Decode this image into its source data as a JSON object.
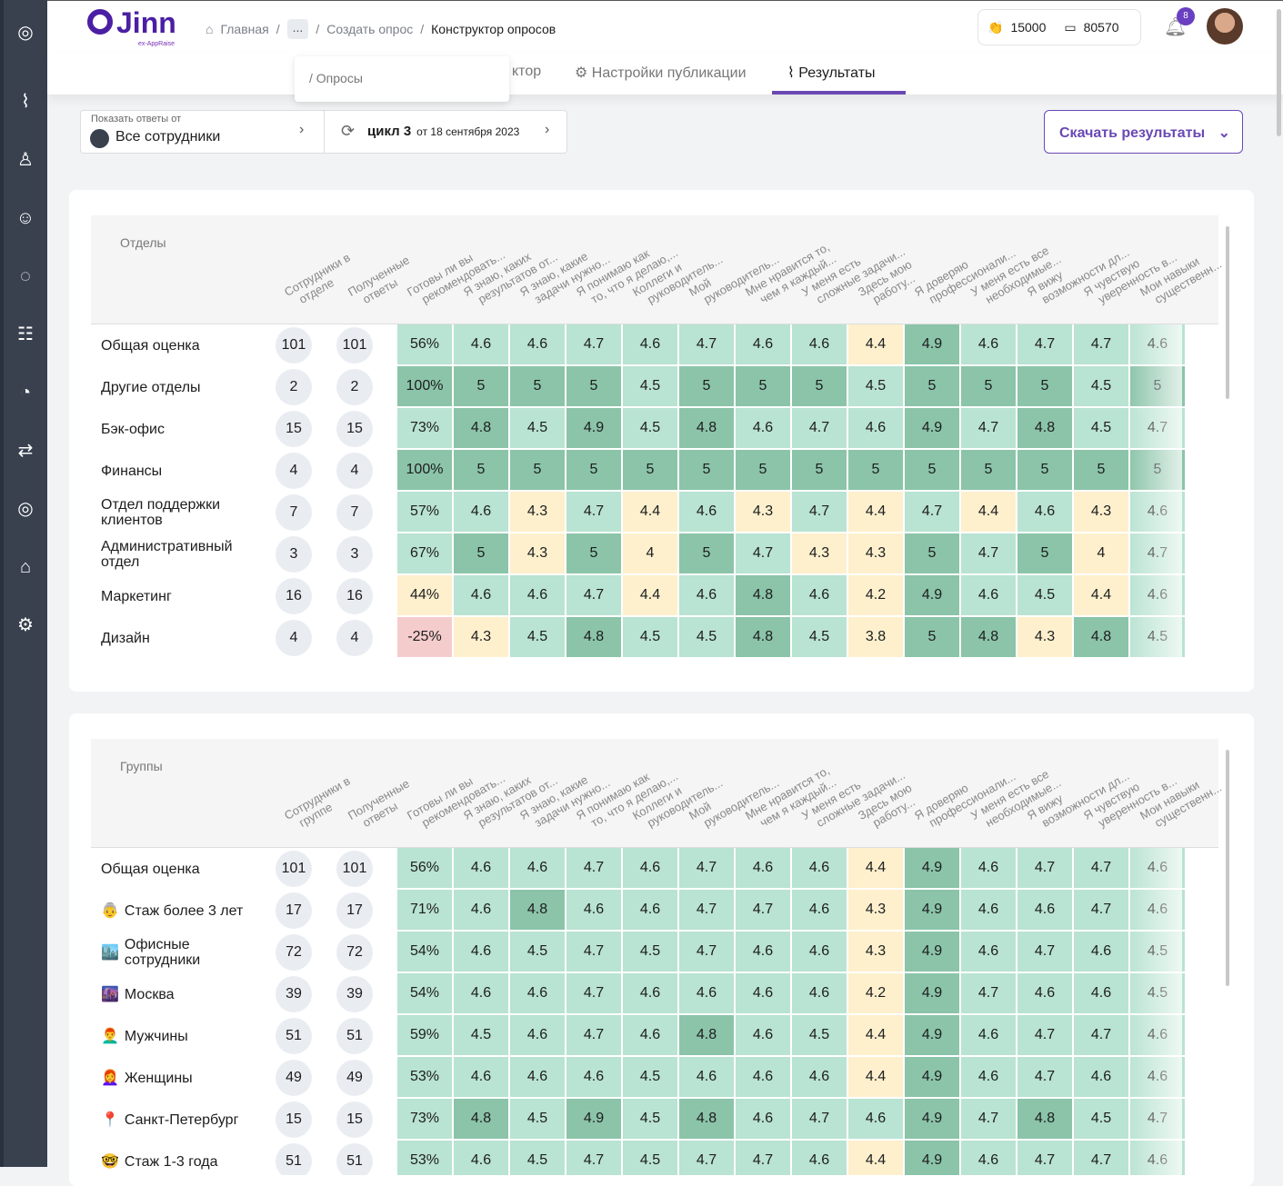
{
  "header": {
    "logo": "Jinn",
    "logo_sub": "ex-AppRaise",
    "breadcrumbs": [
      "Главная",
      "...",
      "Создать опрос",
      "Конструктор опросов"
    ],
    "claps": "15000",
    "wallet": "80570",
    "notifications": "8"
  },
  "breadcrumb_popup": {
    "item": "Опросы"
  },
  "tabs": [
    {
      "label": "Конструктор",
      "visible_text": "ктор"
    },
    {
      "label": "Настройки публикации"
    },
    {
      "label": "Результаты",
      "active": true
    }
  ],
  "filter": {
    "caption": "Показать ответы от",
    "value": "Все сотрудники",
    "cycle": "цикл 3",
    "cycle_date": "от 18 сентября 2023"
  },
  "download_label": "Скачать результаты",
  "colors": {
    "accent": "#6a48b4",
    "high": "#8bc4a9",
    "mid": "#b9e3d2",
    "low": "#fef0cd",
    "negative": "#f5cccc"
  },
  "question_headers": [
    [
      "Готовы ли вы",
      "рекомендовать..."
    ],
    [
      "Я знаю, каких",
      "результатов от..."
    ],
    [
      "Я знаю, какие",
      "задачи нужно..."
    ],
    [
      "Я понимаю как",
      "то, что я делаю,..."
    ],
    [
      "Коллеги и",
      "руководитель..."
    ],
    [
      "Мой",
      "руководитель..."
    ],
    [
      "Мне нравится то,",
      "чем я каждый..."
    ],
    [
      "У меня есть",
      "сложные задачи..."
    ],
    [
      "Здесь мою",
      "работу..."
    ],
    [
      "Я доверяю",
      "профессионали..."
    ],
    [
      "У меня есть все",
      "необходимые..."
    ],
    [
      "Я вижу",
      "возможности дл..."
    ],
    [
      "Я чувствую",
      "уверенность в..."
    ],
    [
      "Мои навыки",
      "существенн..."
    ]
  ],
  "departments": {
    "title": "Отделы",
    "col_employees": [
      "Сотрудники в",
      "отделе"
    ],
    "col_answers": [
      "Полученные",
      "ответы"
    ],
    "rows": [
      {
        "name": "Общая оценка",
        "employees": "101",
        "answers": "101",
        "values": [
          "56%",
          "4.6",
          "4.6",
          "4.7",
          "4.6",
          "4.7",
          "4.6",
          "4.6",
          "4.4",
          "4.9",
          "4.6",
          "4.7",
          "4.7",
          "4.6"
        ]
      },
      {
        "name": "Другие отделы",
        "employees": "2",
        "answers": "2",
        "values": [
          "100%",
          "5",
          "5",
          "5",
          "4.5",
          "5",
          "5",
          "5",
          "4.5",
          "5",
          "5",
          "5",
          "4.5",
          "5"
        ]
      },
      {
        "name": "Бэк-офис",
        "employees": "15",
        "answers": "15",
        "values": [
          "73%",
          "4.8",
          "4.5",
          "4.9",
          "4.5",
          "4.8",
          "4.6",
          "4.7",
          "4.6",
          "4.9",
          "4.7",
          "4.8",
          "4.5",
          "4.7"
        ]
      },
      {
        "name": "Финансы",
        "employees": "4",
        "answers": "4",
        "values": [
          "100%",
          "5",
          "5",
          "5",
          "5",
          "5",
          "5",
          "5",
          "5",
          "5",
          "5",
          "5",
          "5",
          "5"
        ]
      },
      {
        "name": "Отдел поддержки клиентов",
        "employees": "7",
        "answers": "7",
        "values": [
          "57%",
          "4.6",
          "4.3",
          "4.7",
          "4.4",
          "4.6",
          "4.3",
          "4.7",
          "4.4",
          "4.7",
          "4.4",
          "4.6",
          "4.3",
          "4.6"
        ]
      },
      {
        "name": "Административный отдел",
        "employees": "3",
        "answers": "3",
        "values": [
          "67%",
          "5",
          "4.3",
          "5",
          "4",
          "5",
          "4.7",
          "4.3",
          "4.3",
          "5",
          "4.7",
          "5",
          "4",
          "4.7"
        ]
      },
      {
        "name": "Маркетинг",
        "employees": "16",
        "answers": "16",
        "values": [
          "44%",
          "4.6",
          "4.6",
          "4.7",
          "4.4",
          "4.6",
          "4.8",
          "4.6",
          "4.2",
          "4.9",
          "4.6",
          "4.5",
          "4.4",
          "4.6"
        ]
      },
      {
        "name": "Дизайн",
        "employees": "4",
        "answers": "4",
        "values": [
          "-25%",
          "4.3",
          "4.5",
          "4.8",
          "4.5",
          "4.5",
          "4.8",
          "4.5",
          "3.8",
          "5",
          "4.8",
          "4.3",
          "4.8",
          "4.5"
        ]
      }
    ]
  },
  "groups": {
    "title": "Группы",
    "col_employees": [
      "Сотрудники в",
      "группе"
    ],
    "col_answers": [
      "Полученные",
      "ответы"
    ],
    "rows": [
      {
        "name": "Общая оценка",
        "icon": "",
        "employees": "101",
        "answers": "101",
        "values": [
          "56%",
          "4.6",
          "4.6",
          "4.7",
          "4.6",
          "4.7",
          "4.6",
          "4.6",
          "4.4",
          "4.9",
          "4.6",
          "4.7",
          "4.7",
          "4.6"
        ]
      },
      {
        "name": "Стаж более 3 лет",
        "icon": "👵",
        "employees": "17",
        "answers": "17",
        "values": [
          "71%",
          "4.6",
          "4.8",
          "4.6",
          "4.6",
          "4.7",
          "4.7",
          "4.6",
          "4.3",
          "4.9",
          "4.6",
          "4.6",
          "4.7",
          "4.6"
        ]
      },
      {
        "name": "Офисные сотрудники",
        "icon": "🏙️",
        "employees": "72",
        "answers": "72",
        "values": [
          "54%",
          "4.6",
          "4.5",
          "4.7",
          "4.5",
          "4.7",
          "4.6",
          "4.6",
          "4.3",
          "4.9",
          "4.6",
          "4.7",
          "4.6",
          "4.5"
        ]
      },
      {
        "name": "Москва",
        "icon": "🌆",
        "employees": "39",
        "answers": "39",
        "values": [
          "54%",
          "4.6",
          "4.6",
          "4.7",
          "4.6",
          "4.6",
          "4.6",
          "4.6",
          "4.2",
          "4.9",
          "4.7",
          "4.6",
          "4.6",
          "4.5"
        ]
      },
      {
        "name": "Мужчины",
        "icon": "👨‍🦰",
        "employees": "51",
        "answers": "51",
        "values": [
          "59%",
          "4.5",
          "4.6",
          "4.7",
          "4.6",
          "4.8",
          "4.6",
          "4.5",
          "4.4",
          "4.9",
          "4.6",
          "4.7",
          "4.7",
          "4.6"
        ]
      },
      {
        "name": "Женщины",
        "icon": "👩‍🦰",
        "employees": "49",
        "answers": "49",
        "values": [
          "53%",
          "4.6",
          "4.6",
          "4.6",
          "4.5",
          "4.6",
          "4.6",
          "4.6",
          "4.4",
          "4.9",
          "4.6",
          "4.7",
          "4.6",
          "4.6"
        ]
      },
      {
        "name": "Санкт-Петербург",
        "icon": "📍",
        "employees": "15",
        "answers": "15",
        "values": [
          "73%",
          "4.8",
          "4.5",
          "4.9",
          "4.5",
          "4.8",
          "4.6",
          "4.7",
          "4.6",
          "4.9",
          "4.7",
          "4.8",
          "4.5",
          "4.7"
        ]
      },
      {
        "name": "Стаж 1-3 года",
        "icon": "🤓",
        "employees": "51",
        "answers": "51",
        "values": [
          "53%",
          "4.6",
          "4.5",
          "4.7",
          "4.5",
          "4.7",
          "4.7",
          "4.6",
          "4.4",
          "4.9",
          "4.6",
          "4.7",
          "4.7",
          "4.6"
        ]
      }
    ]
  }
}
